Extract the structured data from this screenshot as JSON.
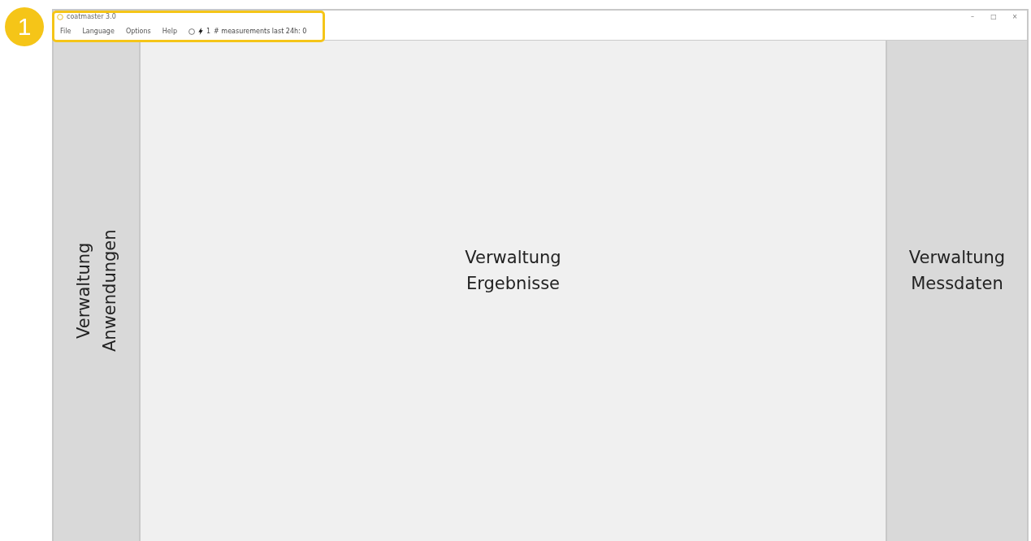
{
  "callout": {
    "number": "1"
  },
  "window": {
    "title": "coatmaster 3.0",
    "controls": [
      "–",
      "□",
      "×"
    ]
  },
  "menu": {
    "items": [
      "File",
      "Language",
      "Options",
      "Help"
    ],
    "status_count": "1",
    "status_text": "# measurements last 24h: 0"
  },
  "panels": [
    {
      "title": "Verwaltung Anwendungen",
      "vertical": true
    },
    {
      "title": "Verwaltung Ergebnisse",
      "vertical": false
    },
    {
      "title": "Verwaltung Messdaten",
      "vertical": false
    }
  ]
}
